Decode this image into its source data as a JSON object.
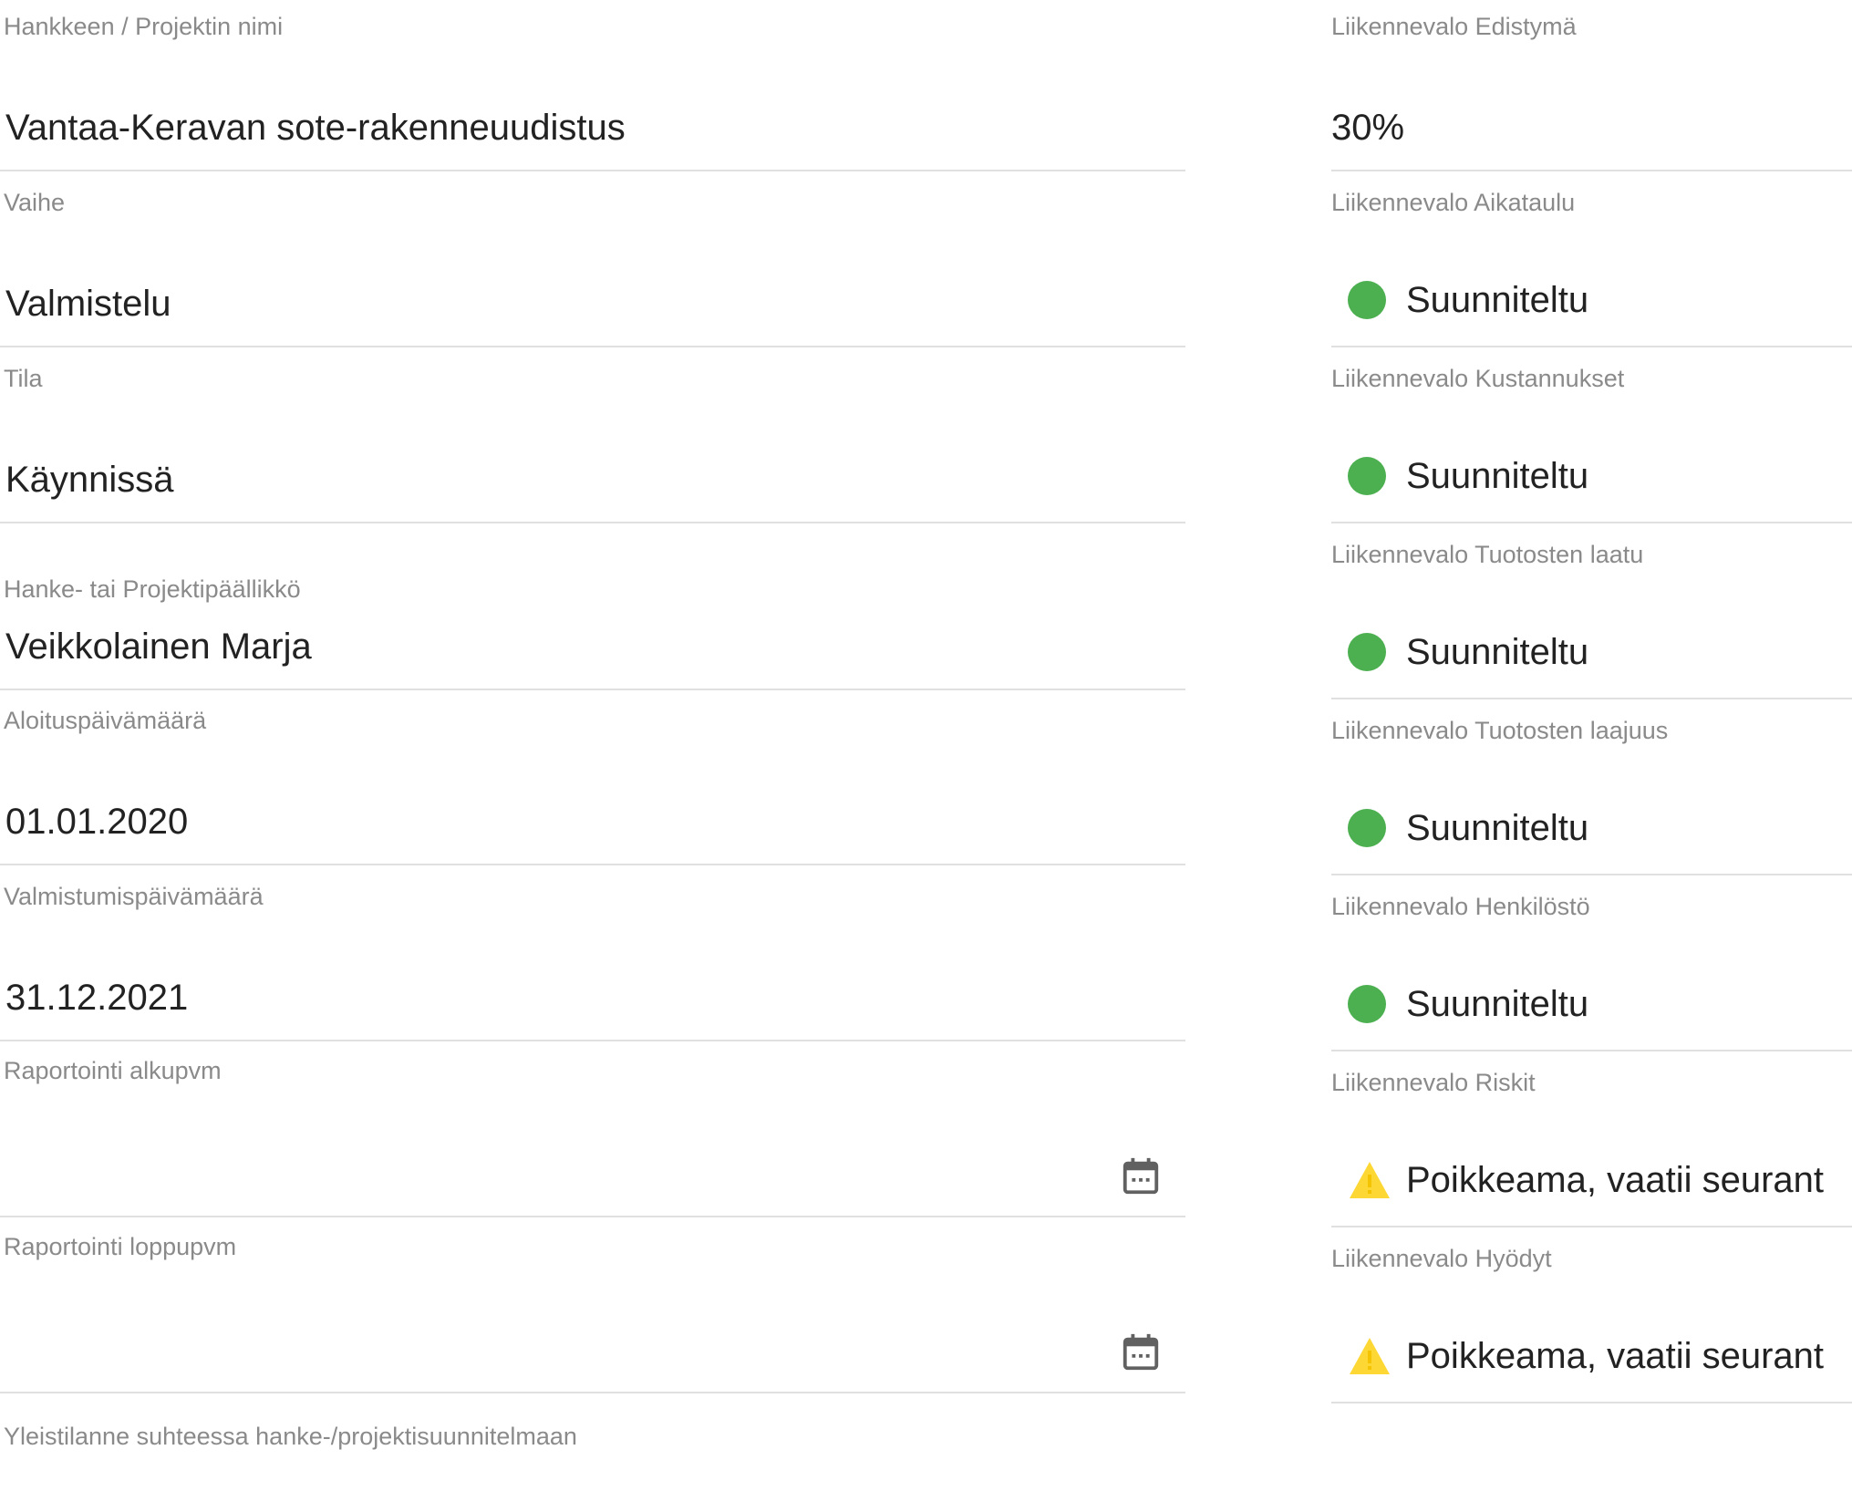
{
  "left": {
    "fields": [
      {
        "label": "Hankkeen / Projektin nimi",
        "value": "Vantaa-Keravan sote-rakenneuudistus"
      },
      {
        "label": "Vaihe",
        "value": "Valmistelu"
      },
      {
        "label": "Tila",
        "value": "Käynnissä"
      },
      {
        "label": "Hanke- tai Projektipäällikkö",
        "value": "Veikkolainen Marja"
      },
      {
        "label": "Aloituspäivämäärä",
        "value": "01.01.2020"
      },
      {
        "label": "Valmistumispäivämäärä",
        "value": "31.12.2021"
      },
      {
        "label": "Raportointi alkupvm",
        "value": ""
      },
      {
        "label": "Raportointi loppupvm",
        "value": ""
      }
    ],
    "bottom_label": "Yleistilanne suhteessa hanke-/projektisuunnitelmaan"
  },
  "right": {
    "fields": [
      {
        "label": "Liikennevalo Edistymä",
        "value": "30%"
      },
      {
        "label": "Liikennevalo Aikataulu",
        "value": "Suunniteltu",
        "status": "green"
      },
      {
        "label": "Liikennevalo Kustannukset",
        "value": "Suunniteltu",
        "status": "green"
      },
      {
        "label": "Liikennevalo Tuotosten laatu",
        "value": "Suunniteltu",
        "status": "green"
      },
      {
        "label": "Liikennevalo Tuotosten laajuus",
        "value": "Suunniteltu",
        "status": "green"
      },
      {
        "label": "Liikennevalo Henkilöstö",
        "value": "Suunniteltu",
        "status": "green"
      },
      {
        "label": "Liikennevalo Riskit",
        "value": "Poikkeama, vaatii seurant",
        "status": "warning"
      },
      {
        "label": "Liikennevalo Hyödyt",
        "value": "Poikkeama, vaatii seurant",
        "status": "warning"
      }
    ]
  },
  "colors": {
    "label": "#8a8a8a",
    "value": "#222222",
    "underline": "#e0e0e0",
    "status_green": "#4caf50",
    "status_warning": "#fdd835",
    "icon": "#616161"
  },
  "icons": {
    "calendar": "calendar-icon",
    "green_status": "green-circle-icon",
    "warning_status": "warning-triangle-icon"
  }
}
